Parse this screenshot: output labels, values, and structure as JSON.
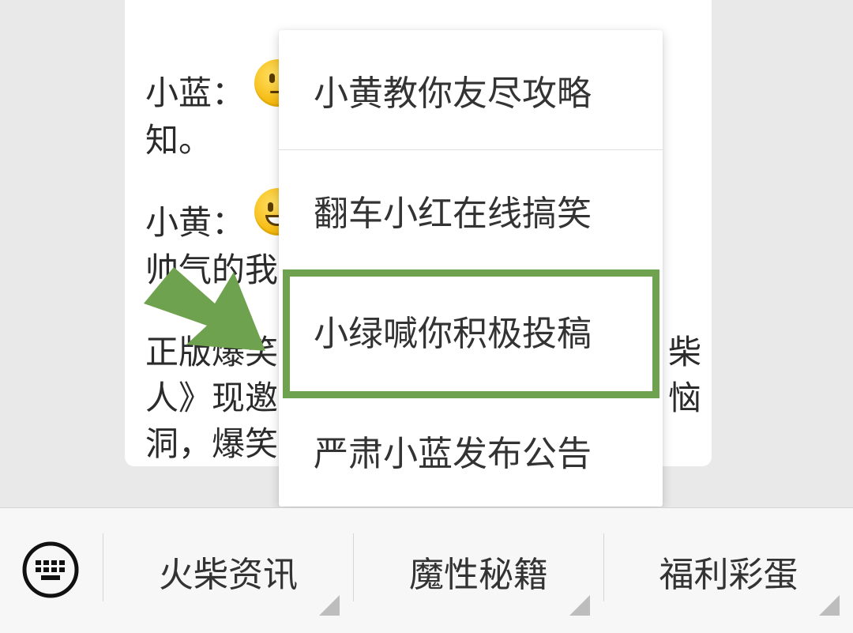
{
  "message": {
    "lines": [
      {
        "text": "小蓝：",
        "row": 0
      },
      {
        "text": "知。",
        "row": 1
      },
      {
        "text": "小黄：",
        "row": 2
      },
      {
        "text": "帅气的我",
        "row": 3
      },
      {
        "text": "正版爆笑",
        "row": 4
      },
      {
        "text": "人》现邀",
        "row": 5
      },
      {
        "text": "洞，爆笑",
        "row": 6
      }
    ],
    "right_fragments": [
      "柴",
      "恼"
    ],
    "emojis": [
      "neutral-face-emoji",
      "grinning-face-emoji"
    ]
  },
  "popup_menu": {
    "items": [
      {
        "label": "小黄教你友尽攻略",
        "highlighted": false
      },
      {
        "label": "翻车小红在线搞笑",
        "highlighted": false
      },
      {
        "label": "小绿喊你积极投稿",
        "highlighted": true
      },
      {
        "label": "严肃小蓝发布公告",
        "highlighted": false
      }
    ]
  },
  "annotation": {
    "color": "#6fa24e",
    "arrow_icon": "arrow-down-right-icon"
  },
  "bottom_bar": {
    "keyboard_icon": "keyboard-icon",
    "items": [
      {
        "label": "火柴资讯"
      },
      {
        "label": "魔性秘籍"
      },
      {
        "label": "福利彩蛋"
      }
    ]
  }
}
